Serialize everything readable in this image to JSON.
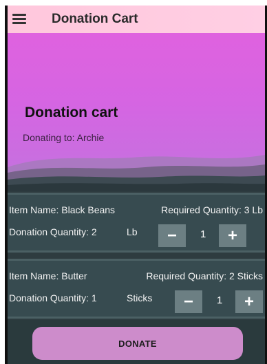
{
  "appbar": {
    "title": "Donation Cart",
    "menu_icon": "hamburger-menu-icon"
  },
  "hero": {
    "title": "Donation cart",
    "subtitle": "Donating to: Archie"
  },
  "items": [
    {
      "name_label": "Item Name: Black Beans",
      "required_label": "Required Quantity:  3 Lb",
      "donation_label": "Donation Quantity:  2",
      "unit": "Lb",
      "minus": "−",
      "quantity": "1",
      "plus": "+"
    },
    {
      "name_label": "Item Name: Butter",
      "required_label": "Required Quantity:  2 Sticks",
      "donation_label": "Donation Quantity:  1",
      "unit": "Sticks",
      "minus": "−",
      "quantity": "1",
      "plus": "+"
    }
  ],
  "actions": {
    "donate_label": "DONATE"
  },
  "colors": {
    "appbar": "#ffc7dc",
    "hero": "#d565e2",
    "card": "#374b50",
    "button": "#6c7f83",
    "donate": "#cd8ccb"
  }
}
